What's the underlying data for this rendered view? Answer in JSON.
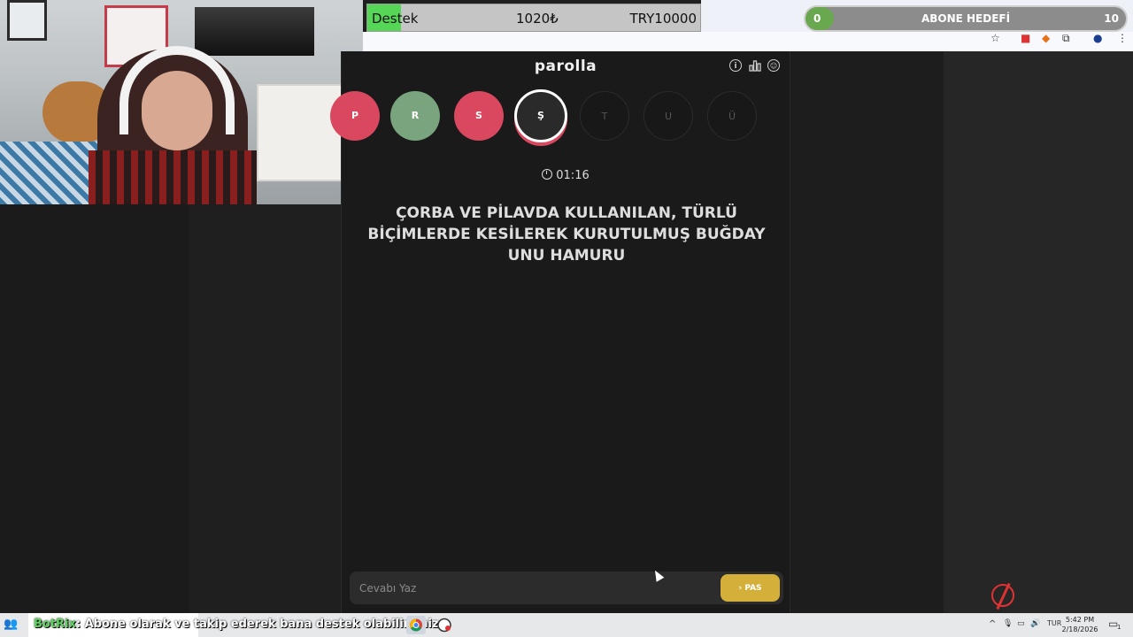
{
  "overlay": {
    "support_label": "Destek",
    "support_current": "1020₺",
    "support_goal": "TRY10000",
    "support_progress": 0.102,
    "sub_current": "0",
    "sub_label": "ABONE HEDEFİ",
    "sub_target": "10"
  },
  "game": {
    "title": "parolla",
    "timer": "01:16",
    "question": "ÇORBA VE PİLAVDA KULLANILAN, TÜRLÜ BİÇİMLERDE KESİLEREK KURUTULMUŞ BUĞDAY UNU HAMURU",
    "letters": [
      {
        "letter": "P",
        "state": "wrong"
      },
      {
        "letter": "R",
        "state": "correct"
      },
      {
        "letter": "S",
        "state": "wrong"
      },
      {
        "letter": "Ş",
        "state": "active"
      },
      {
        "letter": "T",
        "state": "pending"
      },
      {
        "letter": "U",
        "state": "pending"
      },
      {
        "letter": "Ü",
        "state": "pending"
      }
    ],
    "answer_placeholder": "Cevabı Yaz",
    "pass_label": "PAS"
  },
  "taskbar": {
    "ticker_brand": "BotRix",
    "ticker_message": ": Abone olarak ve takip ederek bana destek olabilirsiniz",
    "language": "TUR",
    "time": "5:42 PM",
    "date": "2/18/2026",
    "notification_count": "1"
  },
  "colors": {
    "wrong": "#d9485f",
    "correct": "#7aa47e",
    "pass": "#d4b03a",
    "support_fill": "#56d656"
  }
}
